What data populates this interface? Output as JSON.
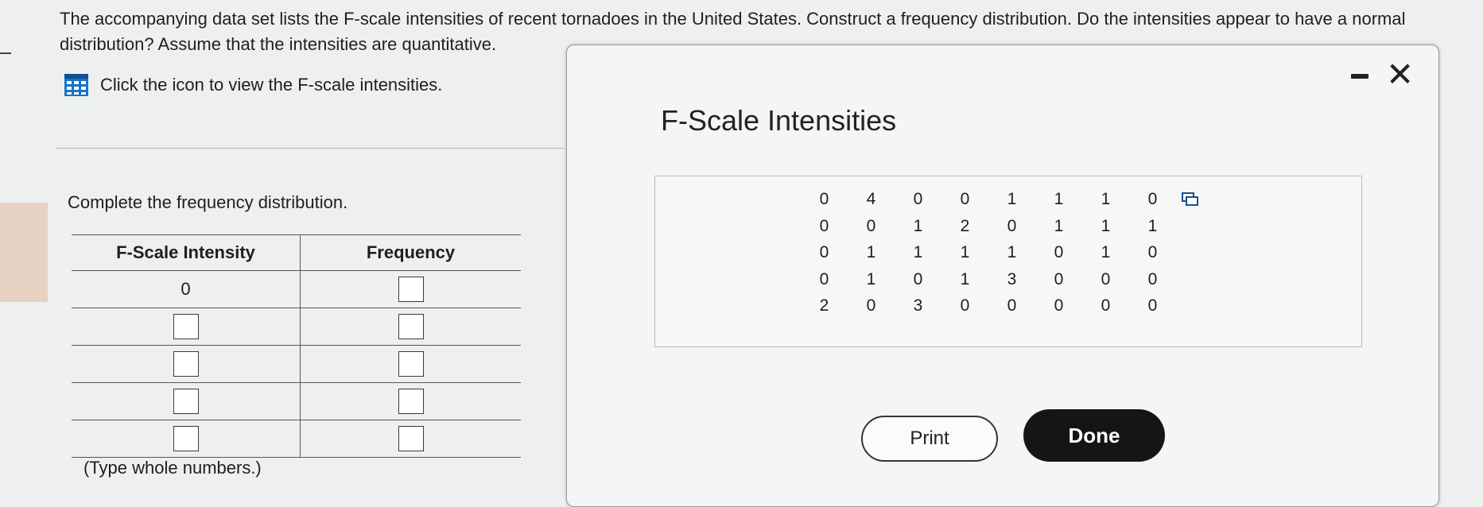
{
  "question": {
    "text": "The accompanying data set lists the F-scale intensities of recent tornadoes in the United States. Construct a frequency distribution. Do the intensities appear to have a normal distribution? Assume that the intensities are quantitative."
  },
  "data_link": {
    "label": "Click the icon to view the F-scale intensities.",
    "icon": "grid-table-icon"
  },
  "prompt": {
    "complete_text": "Complete the frequency distribution."
  },
  "freq_table": {
    "headers": [
      "F-Scale Intensity",
      "Frequency"
    ],
    "first_intensity": "0",
    "hint": "(Type whole numbers.)"
  },
  "modal": {
    "title": "F-Scale Intensities",
    "rows": [
      [
        "0",
        "4",
        "0",
        "0",
        "1",
        "1",
        "1",
        "0"
      ],
      [
        "0",
        "0",
        "1",
        "2",
        "0",
        "1",
        "1",
        "1"
      ],
      [
        "0",
        "1",
        "1",
        "1",
        "1",
        "0",
        "1",
        "0"
      ],
      [
        "0",
        "1",
        "0",
        "1",
        "3",
        "0",
        "0",
        "0"
      ],
      [
        "2",
        "0",
        "3",
        "0",
        "0",
        "0",
        "0",
        "0"
      ]
    ],
    "print_label": "Print",
    "done_label": "Done"
  },
  "colors": {
    "accent": "#1a73c9",
    "done_bg": "#151515",
    "tan": "#e6d2c3"
  }
}
